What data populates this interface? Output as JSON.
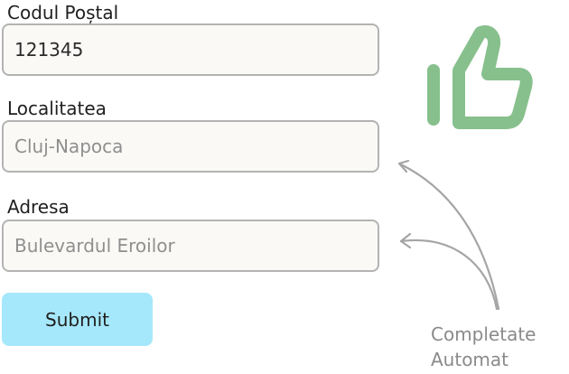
{
  "form": {
    "postal_code": {
      "label": "Codul Poștal",
      "value": "121345"
    },
    "locality": {
      "label": "Localitatea",
      "value": "Cluj-Napoca"
    },
    "address": {
      "label": "Adresa",
      "value": "Bulevardul Eroilor"
    },
    "submit_label": "Submit"
  },
  "annotation": {
    "line1": "Completate",
    "line2": "Automat"
  },
  "colors": {
    "thumbs_up": "#87c08c",
    "submit_background": "#a6e8fb",
    "input_background": "#faf9f6",
    "arrow": "#a5a5a5"
  },
  "icons": {
    "thumbs_up": "thumbs-up-icon",
    "arrows": "curved-arrow-icon"
  }
}
